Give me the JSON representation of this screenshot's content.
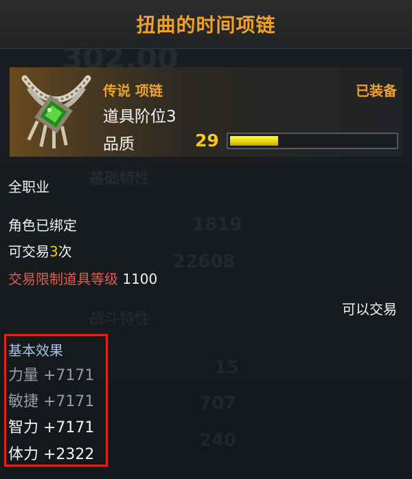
{
  "title": "扭曲的时间项链",
  "item": {
    "rarity_type": "传说 项链",
    "equip_status": "已装备",
    "tier": "道具阶位3",
    "quality_label": "品质",
    "quality_value": "29",
    "quality_progress": 29
  },
  "info": {
    "class": "全职业",
    "bound": "角色已绑定",
    "trade_prefix": "可交易",
    "trade_count": "3",
    "trade_suffix": "次",
    "trade_limit_label": "交易限制道具等级",
    "trade_limit_value": "1100",
    "tradable": "可以交易"
  },
  "effects": {
    "title": "基本效果",
    "stats": [
      {
        "label": "力量 +7171",
        "style": "dim"
      },
      {
        "label": "敏捷 +7171",
        "style": "dim"
      },
      {
        "label": "智力 +7171",
        "style": "bright"
      },
      {
        "label": "体力 +2322",
        "style": "bright"
      }
    ]
  },
  "colors": {
    "title": "#f0a12a",
    "quality": "#f5c71a",
    "trade_limit_label": "#e25b4f",
    "effects_title": "#a6c2e8",
    "highlight_box": "#e0241c"
  }
}
